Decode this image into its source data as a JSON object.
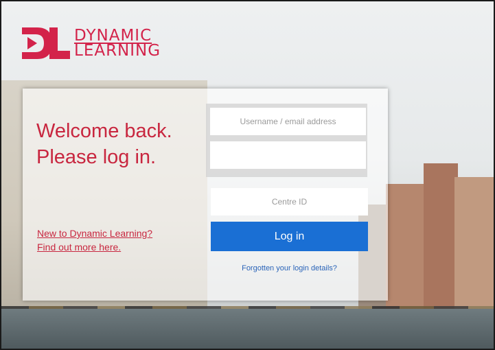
{
  "logo": {
    "line1": "DYNAMIC",
    "line2": "LEARNING"
  },
  "welcome": {
    "line1": "Welcome back.",
    "line2": "Please log in."
  },
  "new_link": {
    "line1": "New to Dynamic Learning?",
    "line2": "Find out more here."
  },
  "form": {
    "username_placeholder": "Username / email address",
    "username_value": "",
    "password_value": "",
    "centre_placeholder": "Centre ID",
    "centre_value": "",
    "login_label": "Log in",
    "forgot_label": "Forgotten your login details?"
  },
  "colors": {
    "brand": "#d3234a",
    "button": "#1a6fd4",
    "link": "#2a64b8"
  }
}
